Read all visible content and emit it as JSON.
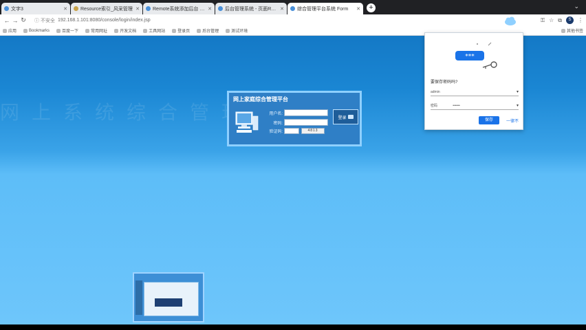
{
  "browser": {
    "tabs": [
      {
        "title": "文字3",
        "active": false,
        "favicon_color": "#4a90d9"
      },
      {
        "title": "Resource索引_风采管理",
        "active": false,
        "favicon_color": "#c8a24a"
      },
      {
        "title": "Remote系统添加后台 服务",
        "active": false,
        "favicon_color": "#4a90d9"
      },
      {
        "title": "后台管理系统 - 页面Report",
        "active": false,
        "favicon_color": "#4a90d9"
      },
      {
        "title": "综合管理平台系统 Form",
        "active": true,
        "favicon_color": "#4a90d9"
      }
    ],
    "new_tab_label": "+",
    "tab_menu_glyph": "⌄",
    "back_glyph": "←",
    "forward_glyph": "→",
    "reload_glyph": "↻",
    "lock_glyph": "ⓘ 不安全",
    "url": "192.168.1.101:8080/console/login/index.jsp",
    "menu_glyph": "⋮",
    "profile_initial": "S",
    "bookmarks": [
      {
        "label": "应用"
      },
      {
        "label": "Bookmarks"
      },
      {
        "label": "百度一下"
      },
      {
        "label": "常用网址"
      },
      {
        "label": "开发文档"
      },
      {
        "label": "工具网站"
      },
      {
        "label": "登录页"
      },
      {
        "label": "后台管理"
      },
      {
        "label": "测试环境"
      }
    ],
    "bookmarks_end": "其他书签"
  },
  "page": {
    "background_watermark": "网上系统综合管理平台",
    "login": {
      "title": "网上家庭综合管理平台",
      "username_label": "用户名:",
      "password_label": "密码:",
      "captcha_label": "验证码:",
      "captcha_value": "4813",
      "login_button": "登录",
      "brand_color": "#2f7fc6"
    }
  },
  "password_popup": {
    "masked_preview": "***",
    "heading": "要保存密码吗?",
    "username_value": "admin",
    "password_label": "密码",
    "password_value": "••••••",
    "save_button": "保存",
    "never_button": "一律不",
    "accent_color": "#1a73e8"
  }
}
